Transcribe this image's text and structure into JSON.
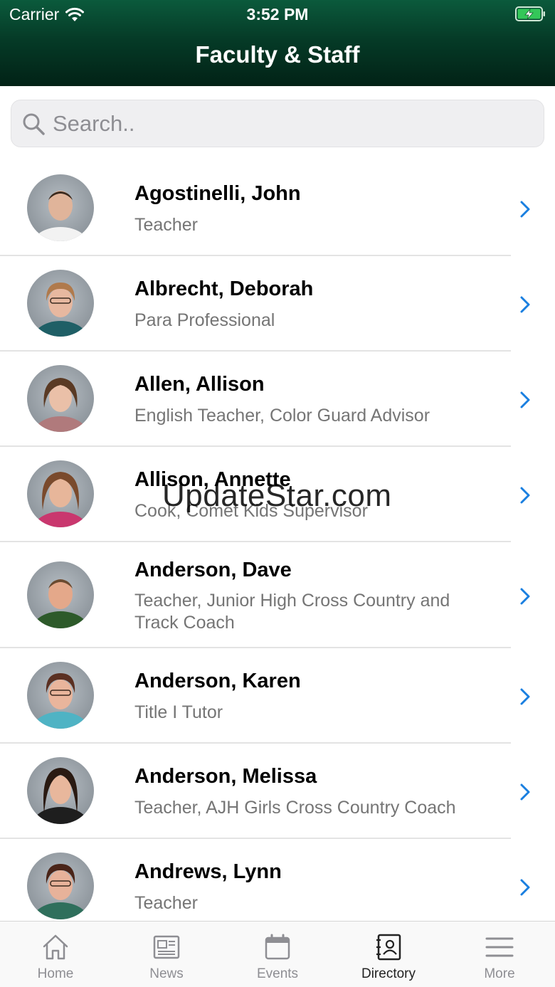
{
  "status_bar": {
    "carrier": "Carrier",
    "time": "3:52 PM",
    "battery_icon": "battery-charging-icon",
    "battery_color": "#34c759"
  },
  "header": {
    "title": "Faculty & Staff",
    "bg_color": "#053b27"
  },
  "search": {
    "placeholder": "Search..",
    "value": ""
  },
  "accent_color": "#1a7fe0",
  "staff": [
    {
      "name": "Agostinelli, John",
      "role": "Teacher"
    },
    {
      "name": "Albrecht, Deborah",
      "role": "Para Professional"
    },
    {
      "name": "Allen, Allison",
      "role": "English Teacher, Color Guard Advisor"
    },
    {
      "name": "Allison, Annette",
      "role": "Cook, Comet Kids Supervisor"
    },
    {
      "name": "Anderson, Dave",
      "role": "Teacher, Junior High Cross Country and Track Coach"
    },
    {
      "name": "Anderson, Karen",
      "role": "Title I Tutor"
    },
    {
      "name": "Anderson, Melissa",
      "role": "Teacher, AJH Girls Cross Country Coach"
    },
    {
      "name": "Andrews, Lynn",
      "role": "Teacher"
    }
  ],
  "watermark": "UpdateStar.com",
  "tabs": [
    {
      "label": "Home",
      "icon": "home-icon"
    },
    {
      "label": "News",
      "icon": "newspaper-icon"
    },
    {
      "label": "Events",
      "icon": "calendar-icon"
    },
    {
      "label": "Directory",
      "icon": "contacts-icon",
      "active": true
    },
    {
      "label": "More",
      "icon": "menu-icon"
    }
  ]
}
